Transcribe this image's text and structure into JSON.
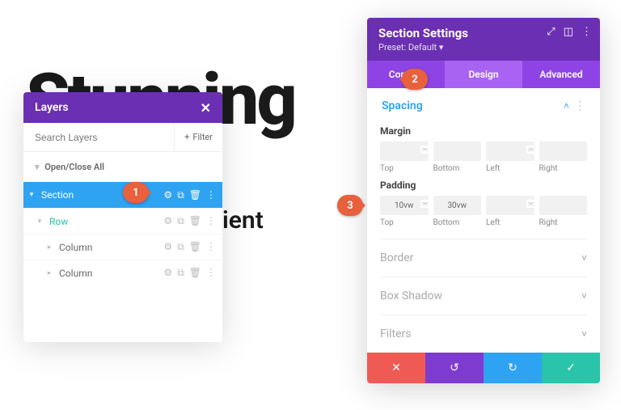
{
  "background": {
    "word_top": "Stunning",
    "word_side": "ient"
  },
  "callouts": {
    "c1": "1",
    "c2": "2",
    "c3": "3"
  },
  "layers": {
    "title": "Layers",
    "search_placeholder": "Search Layers",
    "filter_label": "Filter",
    "open_close": "Open/Close All",
    "section_label": "Section",
    "row_label": "Row",
    "column_label": "Column"
  },
  "settings": {
    "title": "Section Settings",
    "preset": "Preset: Default",
    "tabs": {
      "content": "Content",
      "design": "Design",
      "advanced": "Advanced"
    },
    "spacing": {
      "title": "Spacing",
      "margin_label": "Margin",
      "padding_label": "Padding",
      "cols": {
        "top": "Top",
        "bottom": "Bottom",
        "left": "Left",
        "right": "Right"
      },
      "padding_values": {
        "top": "10vw",
        "bottom": "30vw",
        "left": "",
        "right": ""
      }
    },
    "border": "Border",
    "box_shadow": "Box Shadow",
    "filters": "Filters"
  }
}
